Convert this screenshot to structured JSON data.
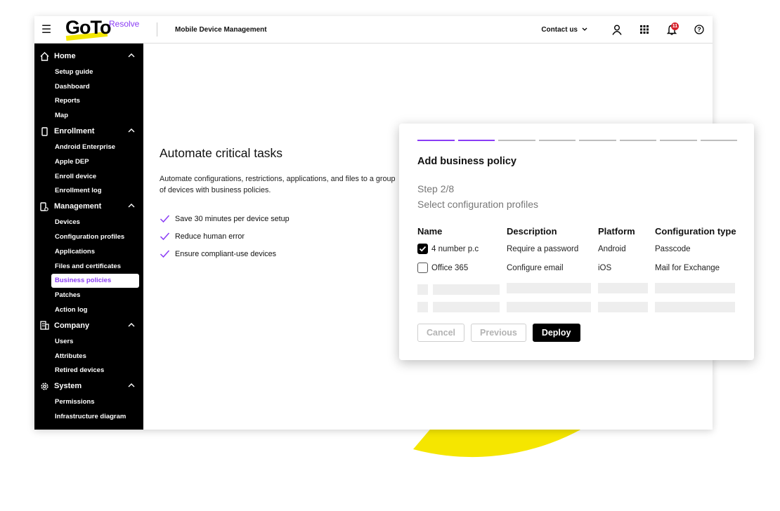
{
  "header": {
    "brand": "GoTo",
    "product": "Resolve",
    "module_title": "Mobile Device Management",
    "contact_label": "Contact us",
    "notification_count": "11"
  },
  "sidebar": {
    "sections": [
      {
        "label": "Home",
        "icon": "home-icon",
        "items": [
          "Setup guide",
          "Dashboard",
          "Reports",
          "Map"
        ]
      },
      {
        "label": "Enrollment",
        "icon": "phone-icon",
        "items": [
          "Android Enterprise",
          "Apple DEP",
          "Enroll device",
          "Enrollment log"
        ]
      },
      {
        "label": "Management",
        "icon": "device-gear-icon",
        "items": [
          "Devices",
          "Configuration profiles",
          "Applications",
          "Files and certificates",
          "Business policies",
          "Patches",
          "Action log"
        ]
      },
      {
        "label": "Company",
        "icon": "building-icon",
        "items": [
          "Users",
          "Attributes",
          "Retired devices"
        ]
      },
      {
        "label": "System",
        "icon": "gear-icon",
        "items": [
          "Permissions",
          "Infrastructure diagram"
        ]
      }
    ],
    "active_item": "Business policies"
  },
  "main": {
    "title": "Automate critical tasks",
    "description": "Automate configurations, restrictions, applications, and files to a group of devices with business policies.",
    "benefits": [
      "Save 30 minutes per device setup",
      "Reduce human error",
      "Ensure compliant-use devices"
    ]
  },
  "modal": {
    "total_steps": 8,
    "current_step": 2,
    "title": "Add business policy",
    "step_label": "Step 2/8",
    "subtitle": "Select configuration profiles",
    "columns": [
      "Name",
      "Description",
      "Platform",
      "Configuration type"
    ],
    "rows": [
      {
        "checked": true,
        "name": "4 number p.c",
        "description": "Require a password",
        "platform": "Android",
        "type": "Passcode"
      },
      {
        "checked": false,
        "name": "Office 365",
        "description": "Configure email",
        "platform": "iOS",
        "type": "Mail for Exchange"
      }
    ],
    "buttons": {
      "cancel": "Cancel",
      "previous": "Previous",
      "deploy": "Deploy"
    }
  },
  "colors": {
    "accent": "#8a3cf5",
    "yellow": "#f5e600",
    "sidebar_bg": "#000000",
    "badge": "#d6212b"
  }
}
